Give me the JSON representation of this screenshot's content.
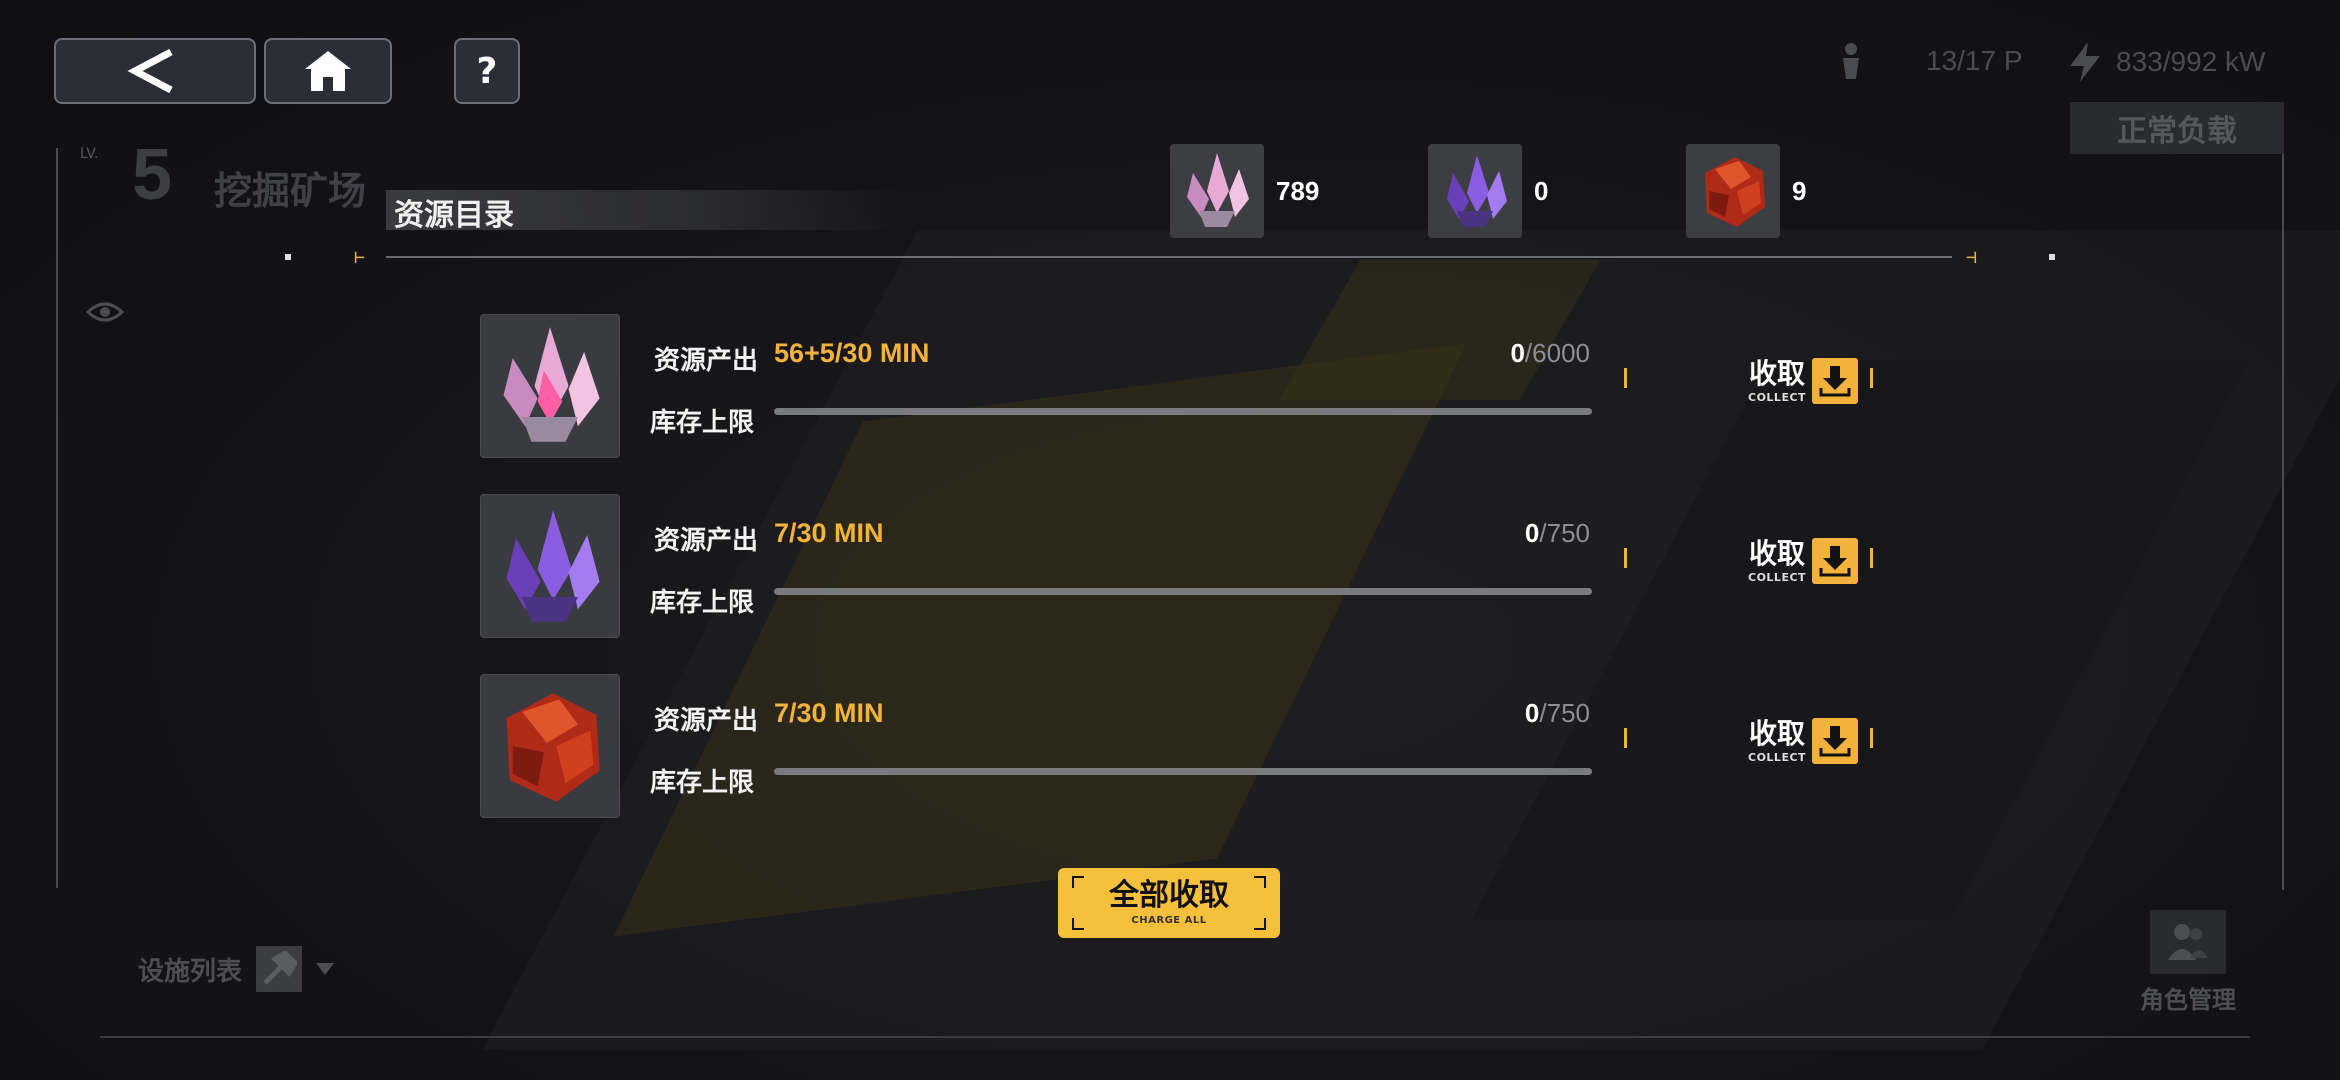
{
  "topbar": {
    "back_label": "<",
    "home_icon": "home-icon",
    "help_label": "?",
    "personnel": "13/17 P",
    "power": "833/992 kW",
    "load_status": "正常负载"
  },
  "facility": {
    "level_prefix": "LV.",
    "level": "5",
    "name": "挖掘矿场"
  },
  "catalog": {
    "title": "资源目录",
    "resources": [
      {
        "name": "pink-crystal",
        "count": "789"
      },
      {
        "name": "purple-crystal",
        "count": "0"
      },
      {
        "name": "red-ore",
        "count": "9"
      }
    ]
  },
  "rows": [
    {
      "output_label": "资源产出",
      "rate": "56+5/30 MIN",
      "cap_label": "库存上限",
      "current": "0",
      "max": "/6000",
      "fill_fraction": 0
    },
    {
      "output_label": "资源产出",
      "rate": "7/30 MIN",
      "cap_label": "库存上限",
      "current": "0",
      "max": "/750",
      "fill_fraction": 0
    },
    {
      "output_label": "资源产出",
      "rate": "7/30 MIN",
      "cap_label": "库存上限",
      "current": "0",
      "max": "/750",
      "fill_fraction": 0
    }
  ],
  "collect": {
    "label": "收取",
    "sub": "COLLECT"
  },
  "charge_all": {
    "label": "全部收取",
    "sub": "CHARGE ALL"
  },
  "bottom": {
    "facility_list": "设施列表",
    "role_management": "角色管理"
  },
  "colors": {
    "accent": "#f3b23c",
    "panel": "#3a3b40"
  }
}
